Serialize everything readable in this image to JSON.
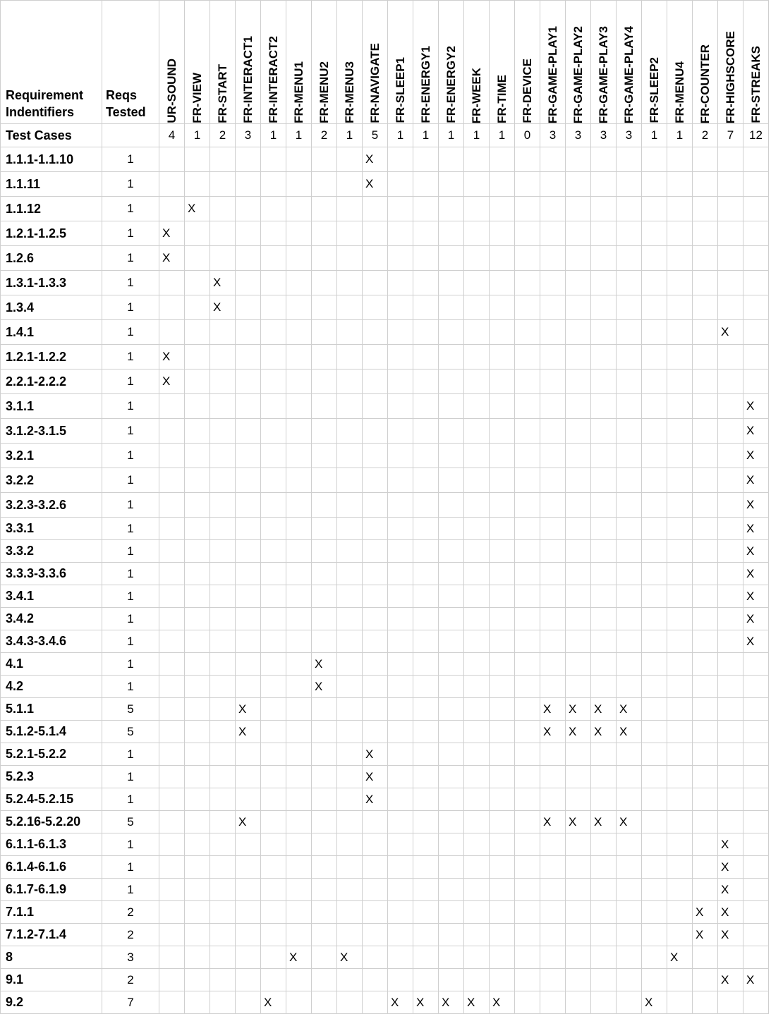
{
  "header": {
    "row_label": "Requirement Indentifiers",
    "tested_label": "Reqs Tested",
    "test_cases_label": "Test Cases"
  },
  "columns": [
    {
      "name": "UR-SOUND",
      "count": "4"
    },
    {
      "name": "FR-VIEW",
      "count": "1"
    },
    {
      "name": "FR-START",
      "count": "2"
    },
    {
      "name": "FR-INTERACT1",
      "count": "3"
    },
    {
      "name": "FR-INTERACT2",
      "count": "1"
    },
    {
      "name": "FR-MENU1",
      "count": "1"
    },
    {
      "name": "FR-MENU2",
      "count": "2"
    },
    {
      "name": "FR-MENU3",
      "count": "1"
    },
    {
      "name": "FR-NAVIGATE",
      "count": "5"
    },
    {
      "name": "FR-SLEEP1",
      "count": "1"
    },
    {
      "name": "FR-ENERGY1",
      "count": "1"
    },
    {
      "name": "FR-ENERGY2",
      "count": "1"
    },
    {
      "name": "FR-WEEK",
      "count": "1"
    },
    {
      "name": "FR-TIME",
      "count": "1"
    },
    {
      "name": "FR-DEVICE",
      "count": "0"
    },
    {
      "name": "FR-GAME-PLAY1",
      "count": "3"
    },
    {
      "name": "FR-GAME-PLAY2",
      "count": "3"
    },
    {
      "name": "FR-GAME-PLAY3",
      "count": "3"
    },
    {
      "name": "FR-GAME-PLAY4",
      "count": "3"
    },
    {
      "name": "FR-SLEEP2",
      "count": "1"
    },
    {
      "name": "FR-MENU4",
      "count": "1"
    },
    {
      "name": "FR-COUNTER",
      "count": "2"
    },
    {
      "name": "FR-HIGHSCORE",
      "count": "7"
    },
    {
      "name": "FR-STREAKS",
      "count": "12"
    }
  ],
  "rows": [
    {
      "id": "1.1.1-1.1.10",
      "tested": "1",
      "cells": [
        "",
        "",
        "",
        "",
        "",
        "",
        "",
        "",
        "X",
        "",
        "",
        "",
        "",
        "",
        "",
        "",
        "",
        "",
        "",
        "",
        "",
        "",
        "",
        ""
      ]
    },
    {
      "id": "1.1.11",
      "tested": "1",
      "cells": [
        "",
        "",
        "",
        "",
        "",
        "",
        "",
        "",
        "X",
        "",
        "",
        "",
        "",
        "",
        "",
        "",
        "",
        "",
        "",
        "",
        "",
        "",
        "",
        ""
      ]
    },
    {
      "id": "1.1.12",
      "tested": "1",
      "cells": [
        "",
        "X",
        "",
        "",
        "",
        "",
        "",
        "",
        "",
        "",
        "",
        "",
        "",
        "",
        "",
        "",
        "",
        "",
        "",
        "",
        "",
        "",
        "",
        ""
      ]
    },
    {
      "id": "1.2.1-1.2.5",
      "tested": "1",
      "cells": [
        "X",
        "",
        "",
        "",
        "",
        "",
        "",
        "",
        "",
        "",
        "",
        "",
        "",
        "",
        "",
        "",
        "",
        "",
        "",
        "",
        "",
        "",
        "",
        ""
      ]
    },
    {
      "id": "1.2.6",
      "tested": "1",
      "cells": [
        "X",
        "",
        "",
        "",
        "",
        "",
        "",
        "",
        "",
        "",
        "",
        "",
        "",
        "",
        "",
        "",
        "",
        "",
        "",
        "",
        "",
        "",
        "",
        ""
      ]
    },
    {
      "id": "1.3.1-1.3.3",
      "tested": "1",
      "cells": [
        "",
        "",
        "X",
        "",
        "",
        "",
        "",
        "",
        "",
        "",
        "",
        "",
        "",
        "",
        "",
        "",
        "",
        "",
        "",
        "",
        "",
        "",
        "",
        ""
      ]
    },
    {
      "id": "1.3.4",
      "tested": "1",
      "cells": [
        "",
        "",
        "X",
        "",
        "",
        "",
        "",
        "",
        "",
        "",
        "",
        "",
        "",
        "",
        "",
        "",
        "",
        "",
        "",
        "",
        "",
        "",
        "",
        ""
      ]
    },
    {
      "id": "1.4.1",
      "tested": "1",
      "cells": [
        "",
        "",
        "",
        "",
        "",
        "",
        "",
        "",
        "",
        "",
        "",
        "",
        "",
        "",
        "",
        "",
        "",
        "",
        "",
        "",
        "",
        "",
        "X",
        ""
      ]
    },
    {
      "id": "1.2.1-1.2.2",
      "tested": "1",
      "cells": [
        "X",
        "",
        "",
        "",
        "",
        "",
        "",
        "",
        "",
        "",
        "",
        "",
        "",
        "",
        "",
        "",
        "",
        "",
        "",
        "",
        "",
        "",
        "",
        ""
      ]
    },
    {
      "id": "2.2.1-2.2.2",
      "tested": "1",
      "cells": [
        "X",
        "",
        "",
        "",
        "",
        "",
        "",
        "",
        "",
        "",
        "",
        "",
        "",
        "",
        "",
        "",
        "",
        "",
        "",
        "",
        "",
        "",
        "",
        ""
      ]
    },
    {
      "id": "3.1.1",
      "tested": "1",
      "cells": [
        "",
        "",
        "",
        "",
        "",
        "",
        "",
        "",
        "",
        "",
        "",
        "",
        "",
        "",
        "",
        "",
        "",
        "",
        "",
        "",
        "",
        "",
        "",
        "X"
      ]
    },
    {
      "id": "3.1.2-3.1.5",
      "tested": "1",
      "cells": [
        "",
        "",
        "",
        "",
        "",
        "",
        "",
        "",
        "",
        "",
        "",
        "",
        "",
        "",
        "",
        "",
        "",
        "",
        "",
        "",
        "",
        "",
        "",
        "X"
      ]
    },
    {
      "id": "3.2.1",
      "tested": "1",
      "cells": [
        "",
        "",
        "",
        "",
        "",
        "",
        "",
        "",
        "",
        "",
        "",
        "",
        "",
        "",
        "",
        "",
        "",
        "",
        "",
        "",
        "",
        "",
        "",
        "X"
      ]
    },
    {
      "id": "3.2.2",
      "tested": "1",
      "cells": [
        "",
        "",
        "",
        "",
        "",
        "",
        "",
        "",
        "",
        "",
        "",
        "",
        "",
        "",
        "",
        "",
        "",
        "",
        "",
        "",
        "",
        "",
        "",
        "X"
      ]
    },
    {
      "id": "3.2.3-3.2.6",
      "tested": "1",
      "cells": [
        "",
        "",
        "",
        "",
        "",
        "",
        "",
        "",
        "",
        "",
        "",
        "",
        "",
        "",
        "",
        "",
        "",
        "",
        "",
        "",
        "",
        "",
        "",
        "X"
      ]
    },
    {
      "id": "3.3.1",
      "tested": "1",
      "cells": [
        "",
        "",
        "",
        "",
        "",
        "",
        "",
        "",
        "",
        "",
        "",
        "",
        "",
        "",
        "",
        "",
        "",
        "",
        "",
        "",
        "",
        "",
        "",
        "X"
      ]
    },
    {
      "id": "3.3.2",
      "tested": "1",
      "cells": [
        "",
        "",
        "",
        "",
        "",
        "",
        "",
        "",
        "",
        "",
        "",
        "",
        "",
        "",
        "",
        "",
        "",
        "",
        "",
        "",
        "",
        "",
        "",
        "X"
      ]
    },
    {
      "id": "3.3.3-3.3.6",
      "tested": "1",
      "cells": [
        "",
        "",
        "",
        "",
        "",
        "",
        "",
        "",
        "",
        "",
        "",
        "",
        "",
        "",
        "",
        "",
        "",
        "",
        "",
        "",
        "",
        "",
        "",
        "X"
      ]
    },
    {
      "id": "3.4.1",
      "tested": "1",
      "cells": [
        "",
        "",
        "",
        "",
        "",
        "",
        "",
        "",
        "",
        "",
        "",
        "",
        "",
        "",
        "",
        "",
        "",
        "",
        "",
        "",
        "",
        "",
        "",
        "X"
      ]
    },
    {
      "id": "3.4.2",
      "tested": "1",
      "cells": [
        "",
        "",
        "",
        "",
        "",
        "",
        "",
        "",
        "",
        "",
        "",
        "",
        "",
        "",
        "",
        "",
        "",
        "",
        "",
        "",
        "",
        "",
        "",
        "X"
      ]
    },
    {
      "id": "3.4.3-3.4.6",
      "tested": "1",
      "cells": [
        "",
        "",
        "",
        "",
        "",
        "",
        "",
        "",
        "",
        "",
        "",
        "",
        "",
        "",
        "",
        "",
        "",
        "",
        "",
        "",
        "",
        "",
        "",
        "X"
      ]
    },
    {
      "id": "4.1",
      "tested": "1",
      "cells": [
        "",
        "",
        "",
        "",
        "",
        "",
        "X",
        "",
        "",
        "",
        "",
        "",
        "",
        "",
        "",
        "",
        "",
        "",
        "",
        "",
        "",
        "",
        "",
        ""
      ]
    },
    {
      "id": "4.2",
      "tested": "1",
      "cells": [
        "",
        "",
        "",
        "",
        "",
        "",
        "X",
        "",
        "",
        "",
        "",
        "",
        "",
        "",
        "",
        "",
        "",
        "",
        "",
        "",
        "",
        "",
        "",
        ""
      ]
    },
    {
      "id": "5.1.1",
      "tested": "5",
      "cells": [
        "",
        "",
        "",
        "X",
        "",
        "",
        "",
        "",
        "",
        "",
        "",
        "",
        "",
        "",
        "",
        "X",
        "X",
        "X",
        "X",
        "",
        "",
        "",
        "",
        ""
      ]
    },
    {
      "id": "5.1.2-5.1.4",
      "tested": "5",
      "cells": [
        "",
        "",
        "",
        "X",
        "",
        "",
        "",
        "",
        "",
        "",
        "",
        "",
        "",
        "",
        "",
        "X",
        "X",
        "X",
        "X",
        "",
        "",
        "",
        "",
        ""
      ]
    },
    {
      "id": "5.2.1-5.2.2",
      "tested": "1",
      "cells": [
        "",
        "",
        "",
        "",
        "",
        "",
        "",
        "",
        "X",
        "",
        "",
        "",
        "",
        "",
        "",
        "",
        "",
        "",
        "",
        "",
        "",
        "",
        "",
        ""
      ]
    },
    {
      "id": "5.2.3",
      "tested": "1",
      "cells": [
        "",
        "",
        "",
        "",
        "",
        "",
        "",
        "",
        "X",
        "",
        "",
        "",
        "",
        "",
        "",
        "",
        "",
        "",
        "",
        "",
        "",
        "",
        "",
        ""
      ]
    },
    {
      "id": "5.2.4-5.2.15",
      "tested": "1",
      "cells": [
        "",
        "",
        "",
        "",
        "",
        "",
        "",
        "",
        "X",
        "",
        "",
        "",
        "",
        "",
        "",
        "",
        "",
        "",
        "",
        "",
        "",
        "",
        "",
        ""
      ]
    },
    {
      "id": "5.2.16-5.2.20",
      "tested": "5",
      "cells": [
        "",
        "",
        "",
        "X",
        "",
        "",
        "",
        "",
        "",
        "",
        "",
        "",
        "",
        "",
        "",
        "X",
        "X",
        "X",
        "X",
        "",
        "",
        "",
        "",
        ""
      ]
    },
    {
      "id": "6.1.1-6.1.3",
      "tested": "1",
      "cells": [
        "",
        "",
        "",
        "",
        "",
        "",
        "",
        "",
        "",
        "",
        "",
        "",
        "",
        "",
        "",
        "",
        "",
        "",
        "",
        "",
        "",
        "",
        "X",
        ""
      ]
    },
    {
      "id": "6.1.4-6.1.6",
      "tested": "1",
      "cells": [
        "",
        "",
        "",
        "",
        "",
        "",
        "",
        "",
        "",
        "",
        "",
        "",
        "",
        "",
        "",
        "",
        "",
        "",
        "",
        "",
        "",
        "",
        "X",
        ""
      ]
    },
    {
      "id": "6.1.7-6.1.9",
      "tested": "1",
      "cells": [
        "",
        "",
        "",
        "",
        "",
        "",
        "",
        "",
        "",
        "",
        "",
        "",
        "",
        "",
        "",
        "",
        "",
        "",
        "",
        "",
        "",
        "",
        "X",
        ""
      ]
    },
    {
      "id": "7.1.1",
      "tested": "2",
      "cells": [
        "",
        "",
        "",
        "",
        "",
        "",
        "",
        "",
        "",
        "",
        "",
        "",
        "",
        "",
        "",
        "",
        "",
        "",
        "",
        "",
        "",
        "X",
        "X",
        ""
      ]
    },
    {
      "id": "7.1.2-7.1.4",
      "tested": "2",
      "cells": [
        "",
        "",
        "",
        "",
        "",
        "",
        "",
        "",
        "",
        "",
        "",
        "",
        "",
        "",
        "",
        "",
        "",
        "",
        "",
        "",
        "",
        "X",
        "X",
        ""
      ]
    },
    {
      "id": "8",
      "tested": "3",
      "cells": [
        "",
        "",
        "",
        "",
        "",
        "X",
        "",
        "X",
        "",
        "",
        "",
        "",
        "",
        "",
        "",
        "",
        "",
        "",
        "",
        "",
        "X",
        "",
        "",
        ""
      ]
    },
    {
      "id": "9.1",
      "tested": "2",
      "cells": [
        "",
        "",
        "",
        "",
        "",
        "",
        "",
        "",
        "",
        "",
        "",
        "",
        "",
        "",
        "",
        "",
        "",
        "",
        "",
        "",
        "",
        "",
        "X",
        "X"
      ]
    },
    {
      "id": "9.2",
      "tested": "7",
      "cells": [
        "",
        "",
        "",
        "",
        "X",
        "",
        "",
        "",
        "",
        "X",
        "X",
        "X",
        "X",
        "X",
        "",
        "",
        "",
        "",
        "",
        "X",
        "",
        "",
        "",
        ""
      ]
    }
  ]
}
